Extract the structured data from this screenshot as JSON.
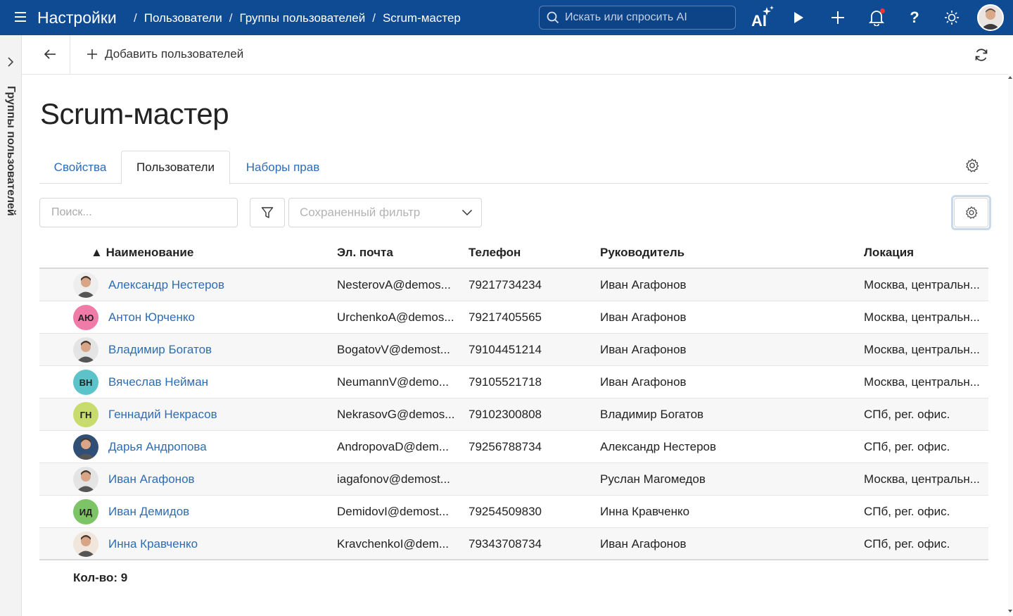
{
  "header": {
    "title": "Настройки",
    "breadcrumbs": [
      "Пользователи",
      "Группы пользователей",
      "Scrum-мастер"
    ],
    "search_placeholder": "Искать или спросить AI",
    "ai_label": "AI",
    "help_label": "?"
  },
  "left_panel": {
    "label": "Группы пользователей"
  },
  "toolbar": {
    "add_users_label": "Добавить пользователей"
  },
  "page": {
    "title": "Scrum-мастер"
  },
  "tabs": [
    {
      "label": "Свойства",
      "active": false
    },
    {
      "label": "Пользователи",
      "active": true
    },
    {
      "label": "Наборы прав",
      "active": false
    }
  ],
  "filters": {
    "search_placeholder": "Поиск...",
    "saved_filter_placeholder": "Сохраненный фильтр"
  },
  "table": {
    "sort_indicator": "▲",
    "columns": [
      "Наименование",
      "Эл. почта",
      "Телефон",
      "Руководитель",
      "Локация"
    ],
    "rows": [
      {
        "avatar": "photo",
        "avatar_bg": "#eeeeee",
        "initials": "",
        "name": "Александр Нестеров",
        "email": "NesterovA@demos...",
        "phone": "79217734234",
        "manager": "Иван Агафонов",
        "location": "Москва, центральн..."
      },
      {
        "avatar": "initials",
        "avatar_bg": "#f07aa8",
        "initials": "АЮ",
        "name": "Антон Юрченко",
        "email": "UrchenkoA@demos...",
        "phone": "79217405565",
        "manager": "Иван Агафонов",
        "location": "Москва, центральн..."
      },
      {
        "avatar": "photo",
        "avatar_bg": "#e4e4e4",
        "initials": "",
        "name": "Владимир Богатов",
        "email": "BogatovV@demost...",
        "phone": "79104451214",
        "manager": "Иван Агафонов",
        "location": "Москва, центральн..."
      },
      {
        "avatar": "initials",
        "avatar_bg": "#5bc3c9",
        "initials": "ВН",
        "name": "Вячеслав Нейман",
        "email": "NeumannV@demo...",
        "phone": "79105521718",
        "manager": "Иван Агафонов",
        "location": "Москва, центральн..."
      },
      {
        "avatar": "initials",
        "avatar_bg": "#c8dc6e",
        "initials": "ГН",
        "name": "Геннадий Некрасов",
        "email": "NekrasovG@demos...",
        "phone": "79102300808",
        "manager": "Владимир Богатов",
        "location": "СПб, рег. офис."
      },
      {
        "avatar": "photo",
        "avatar_bg": "#2f4f77",
        "initials": "",
        "name": "Дарья Андропова",
        "email": "AndropovaD@dem...",
        "phone": "79256788734",
        "manager": "Александр Нестеров",
        "location": "СПб, рег. офис."
      },
      {
        "avatar": "photo",
        "avatar_bg": "#e4e4e4",
        "initials": "",
        "name": "Иван Агафонов",
        "email": "iagafonov@demost...",
        "phone": "",
        "manager": "Руслан Магомедов",
        "location": "Москва, центральн..."
      },
      {
        "avatar": "initials",
        "avatar_bg": "#7cc465",
        "initials": "ИД",
        "name": "Иван Демидов",
        "email": "DemidovI@demost...",
        "phone": "79254509830",
        "manager": "Инна Кравченко",
        "location": "СПб, рег. офис."
      },
      {
        "avatar": "photo",
        "avatar_bg": "#f1e6dc",
        "initials": "",
        "name": "Инна Кравченко",
        "email": "KravchenkoI@dem...",
        "phone": "79343708734",
        "manager": "Иван Агафонов",
        "location": "СПб, рег. офис."
      }
    ],
    "count_label": "Кол-во: 9"
  },
  "colors": {
    "header_bg": "#0f4b93",
    "link": "#2d6cb6",
    "bell_dot": "#e53935"
  }
}
